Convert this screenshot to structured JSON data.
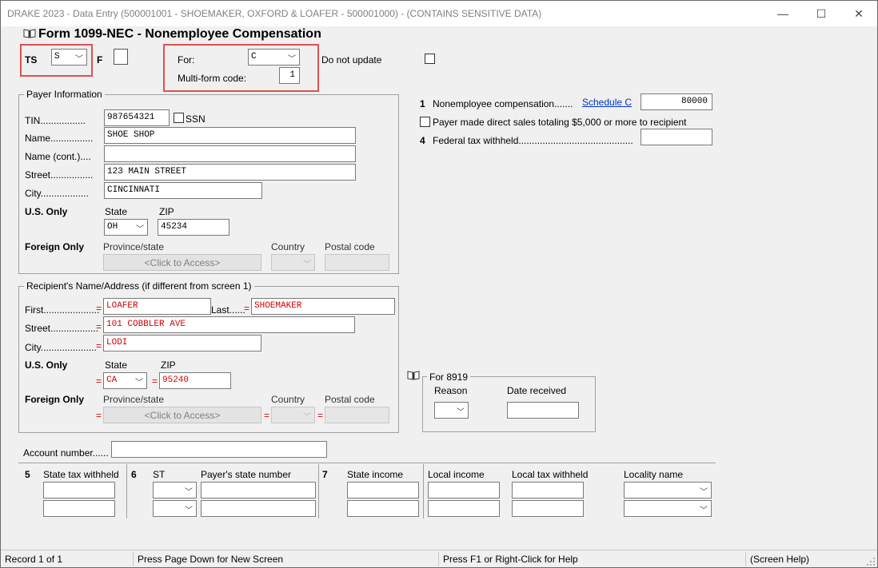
{
  "window": {
    "title": "DRAKE 2023 - Data Entry (500001001 - SHOEMAKER, OXFORD & LOAFER - 500001000) - (CONTAINS SENSITIVE DATA)",
    "minimize": "—",
    "maximize": "☐",
    "close": "✕"
  },
  "form": {
    "title": "Form 1099-NEC - Nonemployee Compensation",
    "ts_label": "TS",
    "ts_value": "S",
    "f_label": "F",
    "for_label": "For:",
    "for_value": "C",
    "multiform_label": "Multi-form code:",
    "multiform_value": "1",
    "do_not_update_label": "Do not update"
  },
  "payer": {
    "group_title": "Payer Information",
    "tin_label": "TIN.................",
    "tin_value": "987654321",
    "ssn_label": "SSN",
    "name_label": "Name................",
    "name_value": "SHOE SHOP",
    "name_cont_label": "Name (cont.)....",
    "name_cont_value": "",
    "street_label": "Street................",
    "street_value": "123 MAIN STREET",
    "city_label": "City..................",
    "city_value": "CINCINNATI",
    "us_only_label": "U.S. Only",
    "state_label": "State",
    "state_value": "OH",
    "zip_label": "ZIP",
    "zip_value": "45234",
    "foreign_only_label": "Foreign Only",
    "province_label": "Province/state",
    "province_button": "<Click to Access>",
    "country_label": "Country",
    "postal_label": "Postal code"
  },
  "recipient": {
    "group_title": "Recipient's Name/Address (if different from screen 1)",
    "first_label": "First.....................",
    "first_value": "LOAFER",
    "last_label": "Last......",
    "last_value": "SHOEMAKER",
    "street_label": "Street..................",
    "street_value": "101 COBBLER AVE",
    "city_label": "City.....................",
    "city_value": "LODI",
    "us_only_label": "U.S. Only",
    "state_label": "State",
    "state_value": "CA",
    "zip_label": "ZIP",
    "zip_value": "95240",
    "foreign_only_label": "Foreign Only",
    "province_label": "Province/state",
    "province_button": "<Click to Access>",
    "country_label": "Country",
    "postal_label": "Postal code",
    "eq": "="
  },
  "boxes": {
    "box1_num": "1",
    "box1_label": "Nonemployee compensation.......",
    "schedule_c_link": "Schedule C",
    "box1_value": "80000",
    "direct_sales_label": "Payer made direct sales totaling $5,000 or more to recipient",
    "box4_num": "4",
    "box4_label": "Federal tax withheld...........................................",
    "box4_value": ""
  },
  "f8919": {
    "group_title": "For 8919",
    "reason_label": "Reason",
    "date_label": "Date received"
  },
  "account": {
    "label": "Account number......",
    "value": ""
  },
  "state_table": {
    "box5_num": "5",
    "state_tax_withheld": "State tax withheld",
    "box6_num": "6",
    "st": "ST",
    "payer_state_number": "Payer's state number",
    "box7_num": "7",
    "state_income": "State income",
    "local_income": "Local income",
    "local_tax_withheld": "Local tax withheld",
    "locality_name": "Locality name"
  },
  "status": {
    "record": "Record 1 of 1",
    "page_down": "Press Page Down for New Screen",
    "f1_help": "Press F1 or Right-Click for Help",
    "screen_help": "(Screen Help)"
  },
  "colors": {
    "highlight_box": "#e05050",
    "recipient_text": "#d40000",
    "link": "#0033cc"
  }
}
